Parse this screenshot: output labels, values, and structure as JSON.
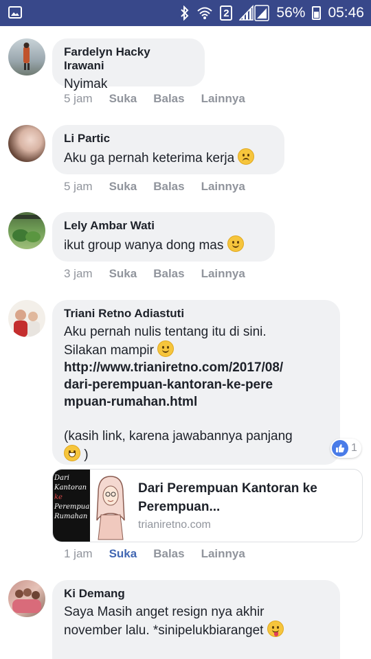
{
  "status_bar": {
    "sim_badge": "2",
    "battery_percent": "56%",
    "time": "05:46",
    "icons": [
      "image-icon",
      "bluetooth-icon",
      "wifi-icon",
      "signal-icon",
      "battery-icon"
    ]
  },
  "comments": [
    {
      "author": "Fardelyn Hacky Irawani",
      "text": "Nyimak",
      "time": "5 jam",
      "like_label": "Suka",
      "reply_label": "Balas",
      "more_label": "Lainnya"
    },
    {
      "author": "Li Partic",
      "text": "Aku ga pernah keterima kerja",
      "emoji": "sad-face-emoji",
      "time": "5 jam",
      "like_label": "Suka",
      "reply_label": "Balas",
      "more_label": "Lainnya"
    },
    {
      "author": "Lely Ambar Wati",
      "text": "ikut group wanya dong mas",
      "emoji": "smile-emoji",
      "time": "3 jam",
      "like_label": "Suka",
      "reply_label": "Balas",
      "more_label": "Lainnya"
    },
    {
      "author": "Triani Retno Adiastuti",
      "text_line1": "Aku pernah nulis tentang itu di sini.",
      "text_line2": "Silakan mampir",
      "link_line1": "http://www.trianiretno.com/2017/08/",
      "link_line2": "dari-perempuan-kantoran-ke-pere",
      "link_line3": "mpuan-rumahan.html",
      "text_line3": "(kasih link, karena jawabannya panjang",
      "text_line4": ")",
      "reaction_count": "1",
      "time": "1 jam",
      "like_label": "Suka",
      "reply_label": "Balas",
      "more_label": "Lainnya",
      "liked": true,
      "preview": {
        "title": "Dari Perempuan Kantoran ke Perempuan...",
        "domain": "trianiretno.com",
        "thumb_text": [
          "Dari",
          "Kantoran",
          "ke",
          "Perempuan",
          "Rumahan"
        ]
      }
    },
    {
      "author": "Ki Demang",
      "text_line1": "Saya Masih anget resign nya akhir",
      "text_line2": "november lalu. *sinipelukbiaranget",
      "emoji": "tongue-emoji"
    }
  ],
  "colors": {
    "status_bar": "#38488a",
    "bubble": "#f0f1f3",
    "link_blue": "#4267b2",
    "meta_gray": "#90949c"
  }
}
